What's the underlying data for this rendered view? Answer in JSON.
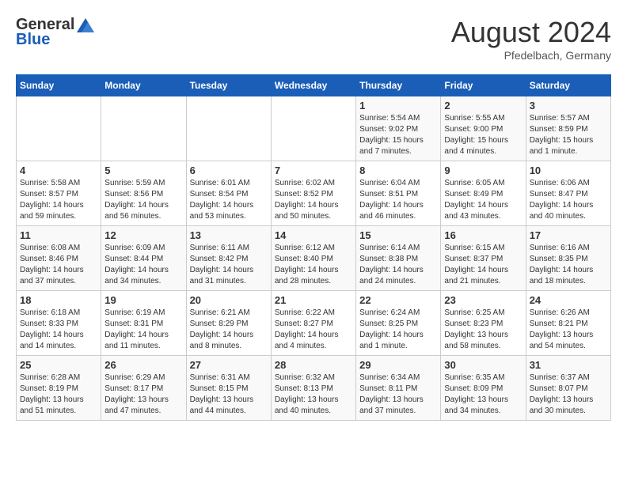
{
  "header": {
    "logo_general": "General",
    "logo_blue": "Blue",
    "month_title": "August 2024",
    "location": "Pfedelbach, Germany"
  },
  "days_of_week": [
    "Sunday",
    "Monday",
    "Tuesday",
    "Wednesday",
    "Thursday",
    "Friday",
    "Saturday"
  ],
  "weeks": [
    [
      {
        "num": "",
        "info": ""
      },
      {
        "num": "",
        "info": ""
      },
      {
        "num": "",
        "info": ""
      },
      {
        "num": "",
        "info": ""
      },
      {
        "num": "1",
        "info": "Sunrise: 5:54 AM\nSunset: 9:02 PM\nDaylight: 15 hours and 7 minutes."
      },
      {
        "num": "2",
        "info": "Sunrise: 5:55 AM\nSunset: 9:00 PM\nDaylight: 15 hours and 4 minutes."
      },
      {
        "num": "3",
        "info": "Sunrise: 5:57 AM\nSunset: 8:59 PM\nDaylight: 15 hours and 1 minute."
      }
    ],
    [
      {
        "num": "4",
        "info": "Sunrise: 5:58 AM\nSunset: 8:57 PM\nDaylight: 14 hours and 59 minutes."
      },
      {
        "num": "5",
        "info": "Sunrise: 5:59 AM\nSunset: 8:56 PM\nDaylight: 14 hours and 56 minutes."
      },
      {
        "num": "6",
        "info": "Sunrise: 6:01 AM\nSunset: 8:54 PM\nDaylight: 14 hours and 53 minutes."
      },
      {
        "num": "7",
        "info": "Sunrise: 6:02 AM\nSunset: 8:52 PM\nDaylight: 14 hours and 50 minutes."
      },
      {
        "num": "8",
        "info": "Sunrise: 6:04 AM\nSunset: 8:51 PM\nDaylight: 14 hours and 46 minutes."
      },
      {
        "num": "9",
        "info": "Sunrise: 6:05 AM\nSunset: 8:49 PM\nDaylight: 14 hours and 43 minutes."
      },
      {
        "num": "10",
        "info": "Sunrise: 6:06 AM\nSunset: 8:47 PM\nDaylight: 14 hours and 40 minutes."
      }
    ],
    [
      {
        "num": "11",
        "info": "Sunrise: 6:08 AM\nSunset: 8:46 PM\nDaylight: 14 hours and 37 minutes."
      },
      {
        "num": "12",
        "info": "Sunrise: 6:09 AM\nSunset: 8:44 PM\nDaylight: 14 hours and 34 minutes."
      },
      {
        "num": "13",
        "info": "Sunrise: 6:11 AM\nSunset: 8:42 PM\nDaylight: 14 hours and 31 minutes."
      },
      {
        "num": "14",
        "info": "Sunrise: 6:12 AM\nSunset: 8:40 PM\nDaylight: 14 hours and 28 minutes."
      },
      {
        "num": "15",
        "info": "Sunrise: 6:14 AM\nSunset: 8:38 PM\nDaylight: 14 hours and 24 minutes."
      },
      {
        "num": "16",
        "info": "Sunrise: 6:15 AM\nSunset: 8:37 PM\nDaylight: 14 hours and 21 minutes."
      },
      {
        "num": "17",
        "info": "Sunrise: 6:16 AM\nSunset: 8:35 PM\nDaylight: 14 hours and 18 minutes."
      }
    ],
    [
      {
        "num": "18",
        "info": "Sunrise: 6:18 AM\nSunset: 8:33 PM\nDaylight: 14 hours and 14 minutes."
      },
      {
        "num": "19",
        "info": "Sunrise: 6:19 AM\nSunset: 8:31 PM\nDaylight: 14 hours and 11 minutes."
      },
      {
        "num": "20",
        "info": "Sunrise: 6:21 AM\nSunset: 8:29 PM\nDaylight: 14 hours and 8 minutes."
      },
      {
        "num": "21",
        "info": "Sunrise: 6:22 AM\nSunset: 8:27 PM\nDaylight: 14 hours and 4 minutes."
      },
      {
        "num": "22",
        "info": "Sunrise: 6:24 AM\nSunset: 8:25 PM\nDaylight: 14 hours and 1 minute."
      },
      {
        "num": "23",
        "info": "Sunrise: 6:25 AM\nSunset: 8:23 PM\nDaylight: 13 hours and 58 minutes."
      },
      {
        "num": "24",
        "info": "Sunrise: 6:26 AM\nSunset: 8:21 PM\nDaylight: 13 hours and 54 minutes."
      }
    ],
    [
      {
        "num": "25",
        "info": "Sunrise: 6:28 AM\nSunset: 8:19 PM\nDaylight: 13 hours and 51 minutes."
      },
      {
        "num": "26",
        "info": "Sunrise: 6:29 AM\nSunset: 8:17 PM\nDaylight: 13 hours and 47 minutes."
      },
      {
        "num": "27",
        "info": "Sunrise: 6:31 AM\nSunset: 8:15 PM\nDaylight: 13 hours and 44 minutes."
      },
      {
        "num": "28",
        "info": "Sunrise: 6:32 AM\nSunset: 8:13 PM\nDaylight: 13 hours and 40 minutes."
      },
      {
        "num": "29",
        "info": "Sunrise: 6:34 AM\nSunset: 8:11 PM\nDaylight: 13 hours and 37 minutes."
      },
      {
        "num": "30",
        "info": "Sunrise: 6:35 AM\nSunset: 8:09 PM\nDaylight: 13 hours and 34 minutes."
      },
      {
        "num": "31",
        "info": "Sunrise: 6:37 AM\nSunset: 8:07 PM\nDaylight: 13 hours and 30 minutes."
      }
    ]
  ]
}
